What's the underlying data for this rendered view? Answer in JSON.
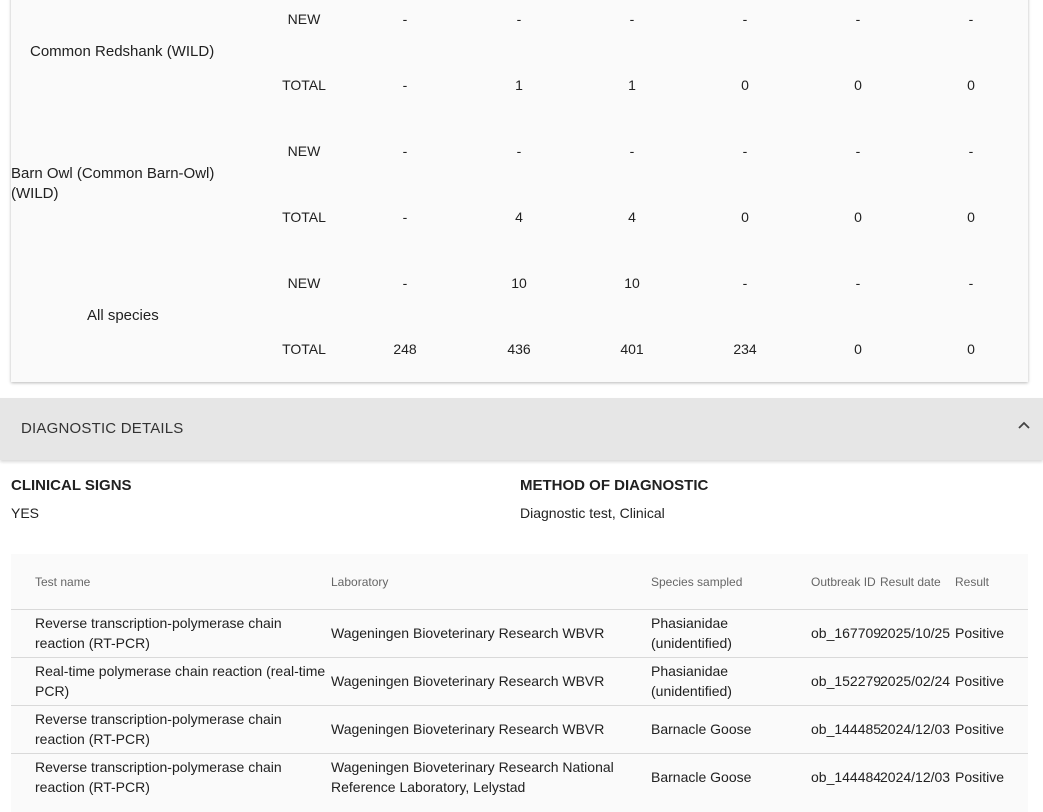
{
  "species_table": {
    "rows": [
      {
        "species": "Common Redshank (WILD)",
        "new_label": "NEW",
        "total_label": "TOTAL",
        "new": [
          "-",
          "-",
          "-",
          "-",
          "-",
          "-"
        ],
        "total": [
          "-",
          "1",
          "1",
          "0",
          "0",
          "0"
        ]
      },
      {
        "species": "Barn Owl (Common Barn-Owl) (WILD)",
        "new_label": "NEW",
        "total_label": "TOTAL",
        "new": [
          "-",
          "-",
          "-",
          "-",
          "-",
          "-"
        ],
        "total": [
          "-",
          "4",
          "4",
          "0",
          "0",
          "0"
        ]
      },
      {
        "species": "All species",
        "new_label": "NEW",
        "total_label": "TOTAL",
        "new": [
          "-",
          "10",
          "10",
          "-",
          "-",
          "-"
        ],
        "total": [
          "248",
          "436",
          "401",
          "234",
          "0",
          "0"
        ]
      }
    ]
  },
  "diagnostic": {
    "section_title": "DIAGNOSTIC DETAILS",
    "clinical_signs_label": "CLINICAL SIGNS",
    "clinical_signs_value": "YES",
    "method_label": "METHOD OF DIAGNOSTIC",
    "method_value": "Diagnostic test, Clinical",
    "colors": {
      "header_bg": "#e6e6e6",
      "card_bg": "#fafafa"
    }
  },
  "tests_table": {
    "headers": {
      "test_name": "Test name",
      "laboratory": "Laboratory",
      "species": "Species sampled",
      "outbreak_id": "Outbreak ID",
      "result_date": "Result date",
      "result": "Result"
    },
    "rows": [
      {
        "test_name": "Reverse transcription-polymerase chain reaction (RT-PCR)",
        "laboratory": "Wageningen Bioveterinary Research WBVR",
        "species": "Phasianidae (unidentified)",
        "outbreak_id": "ob_167709",
        "result_date": "2025/10/25",
        "result": "Positive"
      },
      {
        "test_name": "Real-time polymerase chain reaction (real-time PCR)",
        "laboratory": "Wageningen Bioveterinary Research WBVR",
        "species": "Phasianidae (unidentified)",
        "outbreak_id": "ob_152279",
        "result_date": "2025/02/24",
        "result": "Positive"
      },
      {
        "test_name": "Reverse transcription-polymerase chain reaction (RT-PCR)",
        "laboratory": "Wageningen Bioveterinary Research WBVR",
        "species": "Barnacle Goose",
        "outbreak_id": "ob_144485",
        "result_date": "2024/12/03",
        "result": "Positive"
      },
      {
        "test_name": "Reverse transcription-polymerase chain reaction (RT-PCR)",
        "laboratory": "Wageningen Bioveterinary Research National Reference Laboratory, Lelystad",
        "species": "Barnacle Goose",
        "outbreak_id": "ob_144484",
        "result_date": "2024/12/03",
        "result": "Positive"
      }
    ]
  }
}
